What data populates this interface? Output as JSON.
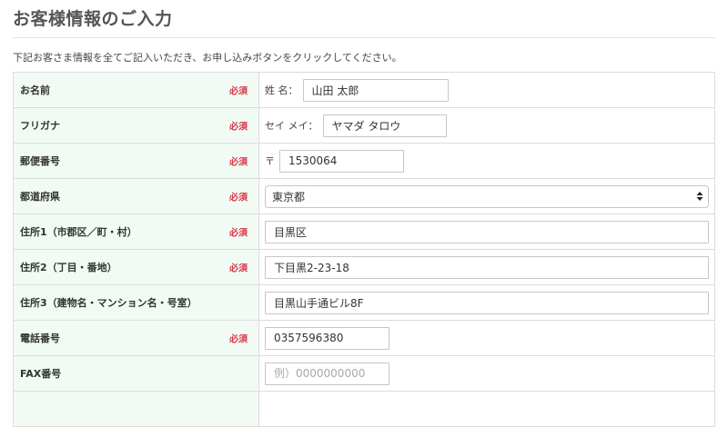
{
  "page": {
    "title": "お客様情報のご入力",
    "note": "下記お客さま情報を全てご記入いただき、お申し込みボタンをクリックしてください。"
  },
  "required_label": "必須",
  "rows": {
    "name": {
      "label": "お名前",
      "prefix": "姓 名：",
      "value": "山田 太郎"
    },
    "kana": {
      "label": "フリガナ",
      "prefix": "セイ メイ：",
      "value": "ヤマダ タロウ"
    },
    "zip": {
      "label": "郵便番号",
      "prefix": "〒",
      "value": "1530064"
    },
    "prefecture": {
      "label": "都道府県",
      "selected": "東京都",
      "arrow_icon": "updown-arrows-icon"
    },
    "address1": {
      "label": "住所1（市郡区／町・村）",
      "value": "目黒区"
    },
    "address2": {
      "label": "住所2（丁目・番地）",
      "value": "下目黒2-23-18"
    },
    "address3": {
      "label": "住所3（建物名・マンション名・号室）",
      "value": "目黒山手通ビル8F"
    },
    "tel": {
      "label": "電話番号",
      "value": "0357596380"
    },
    "fax": {
      "label": "FAX番号",
      "value": "",
      "placeholder": "例）0000000000"
    }
  },
  "colors": {
    "label_bg": "#f1fbf4",
    "required": "#d63a4a",
    "border": "#dcdcdc"
  }
}
